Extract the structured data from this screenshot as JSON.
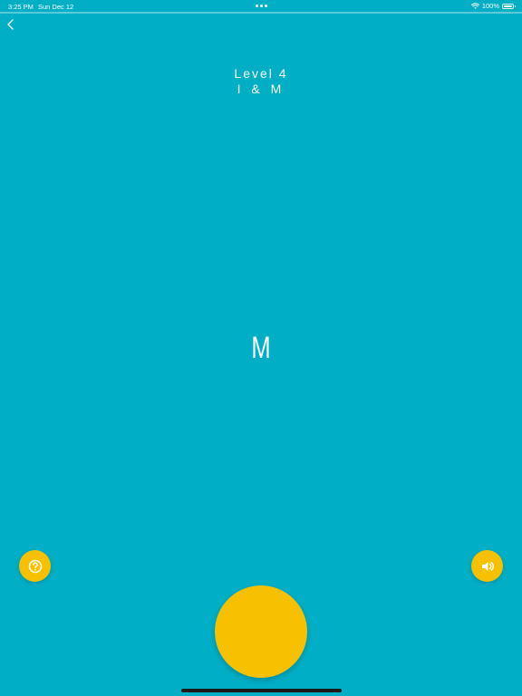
{
  "status_bar": {
    "time": "3:25 PM",
    "date": "Sun Dec 12",
    "battery_text": "100%",
    "battery_level": 1.0
  },
  "header": {
    "back_icon": "chevron-left-icon"
  },
  "level": {
    "title": "Level 4",
    "subtitle": "I & M"
  },
  "main": {
    "current_letter": "M"
  },
  "controls": {
    "help_icon": "question-circle-icon",
    "sound_icon": "speaker-icon",
    "action_button_color": "#f7c001"
  },
  "colors": {
    "background": "#00aec6",
    "accent": "#f7c001"
  }
}
